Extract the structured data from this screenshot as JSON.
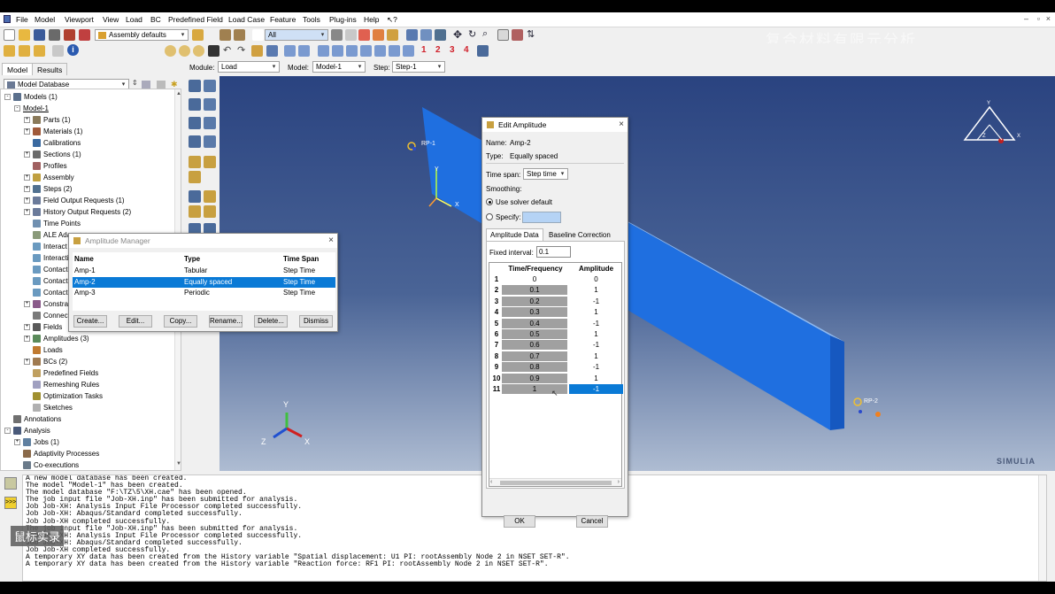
{
  "menubar": {
    "items": [
      "File",
      "Model",
      "Viewport",
      "View",
      "Load",
      "BC",
      "Predefined Field",
      "Load Case",
      "Feature",
      "Tools",
      "Plug-ins",
      "Help",
      "↖?"
    ]
  },
  "toolbar": {
    "assembly_combo": "Assembly defaults",
    "selection_combo": "All",
    "numbers": [
      "1",
      "2",
      "3",
      "4"
    ],
    "watermark": "复合材料有限元分析"
  },
  "context": {
    "module_label": "Module:",
    "module_value": "Load",
    "model_label": "Model:",
    "model_value": "Model-1",
    "step_label": "Step:",
    "step_value": "Step-1"
  },
  "tabs": [
    "Model",
    "Results"
  ],
  "tree": {
    "database": "Model Database",
    "items": [
      {
        "label": "Models (1)",
        "level": 0,
        "exp": "-"
      },
      {
        "label": "Model-1",
        "level": 1,
        "exp": "-"
      },
      {
        "label": "Parts (1)",
        "level": 2,
        "exp": "+"
      },
      {
        "label": "Materials (1)",
        "level": 2,
        "exp": "+"
      },
      {
        "label": "Calibrations",
        "level": 2,
        "exp": ""
      },
      {
        "label": "Sections (1)",
        "level": 2,
        "exp": "+"
      },
      {
        "label": "Profiles",
        "level": 2,
        "exp": ""
      },
      {
        "label": "Assembly",
        "level": 2,
        "exp": "+"
      },
      {
        "label": "Steps (2)",
        "level": 2,
        "exp": "+"
      },
      {
        "label": "Field Output Requests (1)",
        "level": 2,
        "exp": "+"
      },
      {
        "label": "History Output Requests (2)",
        "level": 2,
        "exp": "+"
      },
      {
        "label": "Time Points",
        "level": 2,
        "exp": ""
      },
      {
        "label": "ALE Ada",
        "level": 2,
        "exp": ""
      },
      {
        "label": "Interact",
        "level": 2,
        "exp": ""
      },
      {
        "label": "Interacti",
        "level": 2,
        "exp": ""
      },
      {
        "label": "Contact",
        "level": 2,
        "exp": ""
      },
      {
        "label": "Contact",
        "level": 2,
        "exp": ""
      },
      {
        "label": "Contact",
        "level": 2,
        "exp": ""
      },
      {
        "label": "Constra",
        "level": 2,
        "exp": "+"
      },
      {
        "label": "Connect",
        "level": 2,
        "exp": ""
      },
      {
        "label": "Fields",
        "level": 2,
        "exp": "+"
      },
      {
        "label": "Amplitudes (3)",
        "level": 2,
        "exp": "+"
      },
      {
        "label": "Loads",
        "level": 2,
        "exp": ""
      },
      {
        "label": "BCs (2)",
        "level": 2,
        "exp": "+"
      },
      {
        "label": "Predefined Fields",
        "level": 2,
        "exp": ""
      },
      {
        "label": "Remeshing Rules",
        "level": 2,
        "exp": ""
      },
      {
        "label": "Optimization Tasks",
        "level": 2,
        "exp": ""
      },
      {
        "label": "Sketches",
        "level": 2,
        "exp": ""
      },
      {
        "label": "Annotations",
        "level": 0,
        "exp": ""
      },
      {
        "label": "Analysis",
        "level": 0,
        "exp": "-"
      },
      {
        "label": "Jobs (1)",
        "level": 1,
        "exp": "+"
      },
      {
        "label": "Adaptivity Processes",
        "level": 1,
        "exp": ""
      },
      {
        "label": "Co-executions",
        "level": 1,
        "exp": ""
      }
    ],
    "item_colors": [
      "#5a6f8c",
      "",
      "#8a7a5a",
      "#a05a3a",
      "#3a6aa0",
      "#6a6a6a",
      "#a06060",
      "#c0a040",
      "#507090",
      "#6a7a9a",
      "#6a7a9a",
      "#7090b0",
      "#8a9a7a",
      "#6a9ac0",
      "#6a9ac0",
      "#6a9ac0",
      "#6a9ac0",
      "#6a9ac0",
      "#8a5a8a",
      "#7a7a7a",
      "#5a5a5a",
      "#5a8a5a",
      "#c07a30",
      "#a07a50",
      "#c0a060",
      "#a0a0c0",
      "#a09030",
      "#b0b0b0",
      "#707070",
      "#4a5a7a",
      "#6080a0",
      "#8a6a4a",
      "#6a7a8a"
    ]
  },
  "amplitude_manager": {
    "title": "Amplitude Manager",
    "columns": [
      "Name",
      "Type",
      "Time Span"
    ],
    "rows": [
      {
        "name": "Amp-1",
        "type": "Tabular",
        "span": "Step Time",
        "selected": false
      },
      {
        "name": "Amp-2",
        "type": "Equally spaced",
        "span": "Step Time",
        "selected": true
      },
      {
        "name": "Amp-3",
        "type": "Periodic",
        "span": "Step Time",
        "selected": false
      }
    ],
    "buttons": [
      "Create...",
      "Edit...",
      "Copy...",
      "Rename...",
      "Delete...",
      "Dismiss"
    ]
  },
  "edit_amplitude": {
    "title": "Edit Amplitude",
    "name_label": "Name:",
    "name_value": "Amp-2",
    "type_label": "Type:",
    "type_value": "Equally spaced",
    "time_span_label": "Time span:",
    "time_span_value": "Step time",
    "smoothing_label": "Smoothing:",
    "use_solver_label": "Use solver default",
    "specify_label": "Specify:",
    "tab_data": "Amplitude Data",
    "tab_baseline": "Baseline Correction",
    "fixed_interval_label": "Fixed interval:",
    "fixed_interval_value": "0.1",
    "columns": [
      "Time/Frequency",
      "Amplitude"
    ],
    "rows": [
      {
        "idx": "1",
        "time": "0",
        "amp": "0"
      },
      {
        "idx": "2",
        "time": "0.1",
        "amp": "1"
      },
      {
        "idx": "3",
        "time": "0.2",
        "amp": "-1"
      },
      {
        "idx": "4",
        "time": "0.3",
        "amp": "1"
      },
      {
        "idx": "5",
        "time": "0.4",
        "amp": "-1"
      },
      {
        "idx": "6",
        "time": "0.5",
        "amp": "1"
      },
      {
        "idx": "7",
        "time": "0.6",
        "amp": "-1"
      },
      {
        "idx": "8",
        "time": "0.7",
        "amp": "1"
      },
      {
        "idx": "9",
        "time": "0.8",
        "amp": "-1"
      },
      {
        "idx": "10",
        "time": "0.9",
        "amp": "1"
      },
      {
        "idx": "11",
        "time": "1",
        "amp": "-1"
      }
    ],
    "ok_label": "OK",
    "cancel_label": "Cancel"
  },
  "viewport": {
    "rp_left": "RP-1",
    "rp_right": "RP-2",
    "axis_x": "X",
    "axis_y": "Y",
    "axis_z": "Z",
    "brand": "SIMULIA",
    "part_color": "#1f6fe0"
  },
  "messages": [
    "A new model database has been created.",
    "The model \"Model-1\" has been created.",
    "The model database \"F:\\TZ\\5\\XH.cae\" has been opened.",
    "The job input file \"Job-XH.inp\" has been submitted for analysis.",
    "Job Job-XH: Analysis Input File Processor completed successfully.",
    "Job Job-XH: Abaqus/Standard completed successfully.",
    "Job Job-XH completed successfully.",
    "The job input file \"Job-XH.inp\" has been submitted for analysis.",
    "Job Job-XH: Analysis Input File Processor completed successfully.",
    "Job Job-XH: Abaqus/Standard completed successfully.",
    "Job Job-XH completed successfully.",
    "A temporary XY data has been created from the History variable \"Spatial displacement: U1 PI: rootAssembly Node 2 in NSET SET-R\".",
    "A temporary XY data has been created from the History variable \"Reaction force: RF1 PI: rootAssembly Node 2 in NSET SET-R\"."
  ],
  "overlay_watermark": "鼠标实录"
}
